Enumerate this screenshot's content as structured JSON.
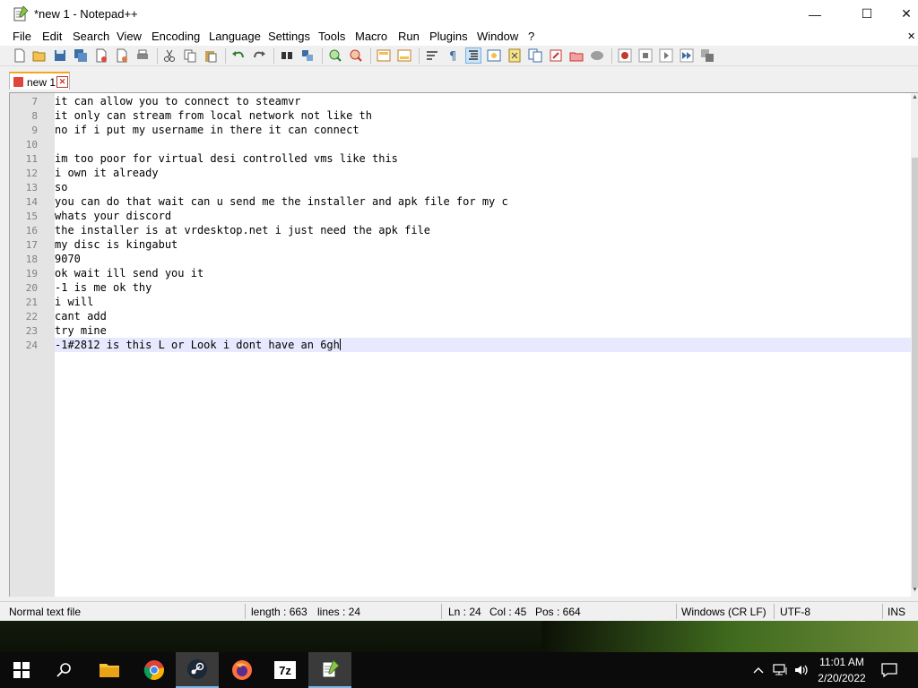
{
  "window": {
    "title": "*new 1 - Notepad++",
    "controls": {
      "minimize": "—",
      "maximize": "☐",
      "close": "✕"
    }
  },
  "menu": [
    "File",
    "Edit",
    "Search",
    "View",
    "Encoding",
    "Language",
    "Settings",
    "Tools",
    "Macro",
    "Run",
    "Plugins",
    "Window",
    "?"
  ],
  "menu_close": "✕",
  "tab": {
    "label": "new 1",
    "close": "✕"
  },
  "editor": {
    "lines": [
      {
        "num": "7",
        "text": "it can allow you to connect to steamvr"
      },
      {
        "num": "8",
        "text": "it only can stream from local network not like th"
      },
      {
        "num": "9",
        "text": "no if i put my username in there it can connect"
      },
      {
        "num": "10",
        "text": ""
      },
      {
        "num": "11",
        "text": "im too poor for virtual desi controlled vms like this"
      },
      {
        "num": "12",
        "text": "i own it already"
      },
      {
        "num": "13",
        "text": "so"
      },
      {
        "num": "14",
        "text": "you can do that wait can u send me the installer and apk file for my c"
      },
      {
        "num": "15",
        "text": "whats your discord"
      },
      {
        "num": "16",
        "text": "the installer is at vrdesktop.net i just need the apk file"
      },
      {
        "num": "17",
        "text": "my disc is kingabut"
      },
      {
        "num": "18",
        "text": "9070"
      },
      {
        "num": "19",
        "text": "ok wait ill send you it"
      },
      {
        "num": "20",
        "text": "-1 is me ok thy"
      },
      {
        "num": "21",
        "text": "i will"
      },
      {
        "num": "22",
        "text": "cant add"
      },
      {
        "num": "23",
        "text": "try mine"
      },
      {
        "num": "24",
        "text": "-1#2812 is this L or Look i dont have an 6gh"
      }
    ],
    "active_line": "24"
  },
  "status": {
    "file_type": "Normal text file",
    "length": "length : 663",
    "lines": "lines : 24",
    "ln": "Ln : 24",
    "col": "Col : 45",
    "pos": "Pos : 664",
    "eol": "Windows (CR LF)",
    "encoding": "UTF-8",
    "mode": "INS"
  },
  "taskbar": {
    "clock_time": "11:01 AM",
    "clock_date": "2/20/2022",
    "sevenzip_label": "7z"
  },
  "colors": {
    "tab_accent": "#f5a623",
    "active_line_bg": "#e8e8ff",
    "taskbar_active_underline": "#76b9ed"
  }
}
